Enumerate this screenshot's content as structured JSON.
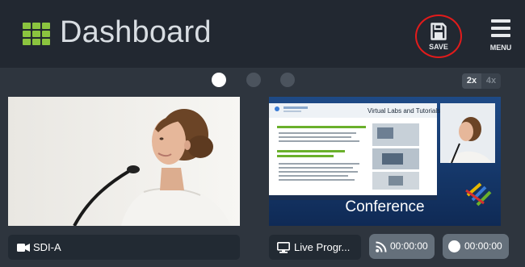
{
  "header": {
    "title": "Dashboard",
    "save_label": "SAVE",
    "menu_label": "MENU"
  },
  "carousel": {
    "page_count": 3,
    "active_page": 1
  },
  "zoom": {
    "option_2x": "2x",
    "option_4x": "4x",
    "selected": "2x"
  },
  "sources": [
    {
      "label": "SDI-A",
      "icon": "video-camera-icon"
    },
    {
      "label": "Live Progr...",
      "icon": "monitor-icon",
      "slide_caption": "Conference",
      "slide_title": "Virtual Labs and Tutorials"
    }
  ],
  "stream_status": {
    "timer": "00:00:00",
    "icon": "rss-icon"
  },
  "record_status": {
    "timer": "00:00:00",
    "icon": "record-icon"
  },
  "colors": {
    "accent": "#8bc43f",
    "highlight_circle": "#e21b1b",
    "topbar": "#222831",
    "background": "#2e353e"
  }
}
